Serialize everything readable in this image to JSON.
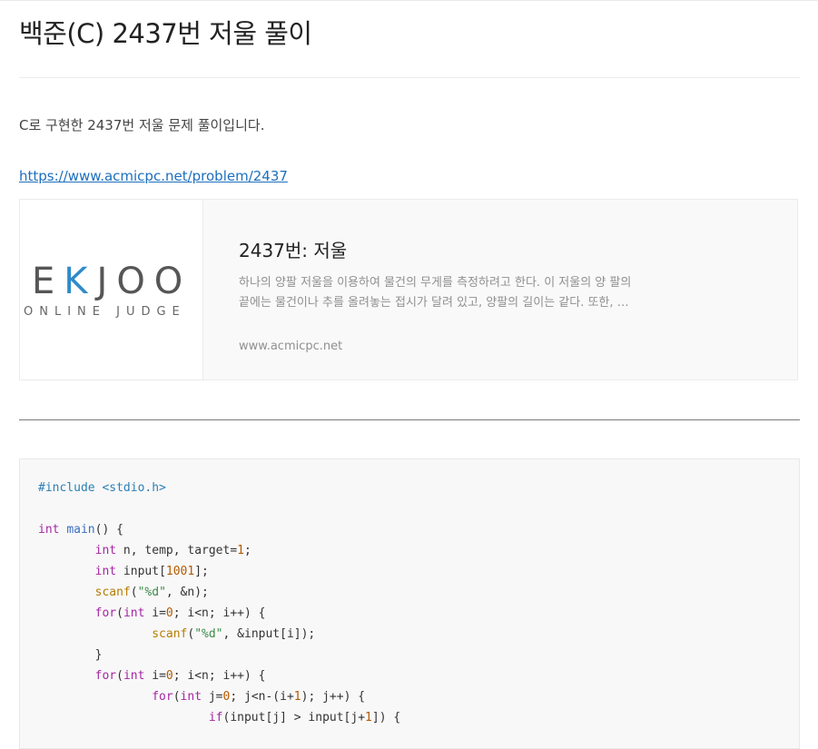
{
  "post": {
    "title": "백준(C) 2437번 저울 풀이",
    "intro": "C로 구현한 2437번 저울 문제 풀이입니다.",
    "link_text": "https://www.acmicpc.net/problem/2437"
  },
  "card": {
    "logo_left": "E",
    "logo_k": "K",
    "logo_right": "JOO",
    "logo_sub": "ONLINE JUDGE",
    "title": "2437번: 저울",
    "desc_line1": "하나의 양팔 저울을 이용하여 물건의 무게를 측정하려고 한다. 이 저울의 양 팔의",
    "desc_line2": "끝에는 물건이나 추를 올려놓는 접시가 달려 있고, 양팔의 길이는 같다. 또한, …",
    "host": "www.acmicpc.net"
  },
  "code": {
    "language": "c",
    "lines": [
      "#include <stdio.h>",
      "",
      "int main() {",
      "        int n, temp, target=1;",
      "        int input[1001];",
      "        scanf(\"%d\", &n);",
      "        for(int i=0; i<n; i++) {",
      "                scanf(\"%d\", &input[i]);",
      "        }",
      "        for(int i=0; i<n; i++) {",
      "                for(int j=0; j<n-(i+1); j++) {",
      "                        if(input[j] > input[j+1]) {"
    ]
  },
  "colors": {
    "link": "#1c6fbd",
    "logo_accent": "#2e8bc9",
    "code_background": "#f8f8f8"
  }
}
